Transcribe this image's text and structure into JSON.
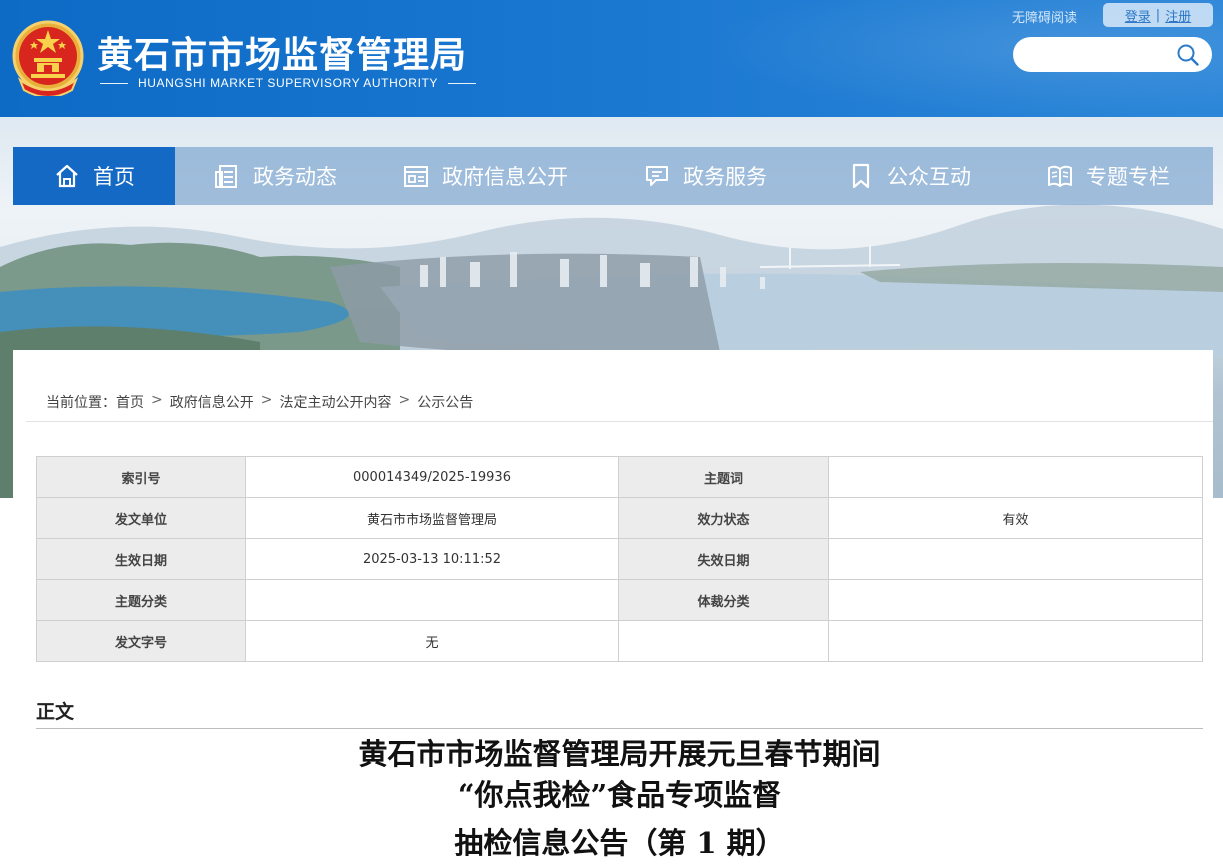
{
  "header": {
    "title": "黄石市市场监督管理局",
    "subtitle": "HUANGSHI MARKET SUPERVISORY AUTHORITY",
    "accessible_reading": "无障碍阅读",
    "login": "登录",
    "register": "注册",
    "auth_separator": "|",
    "search_placeholder": "",
    "emblem_icon": "national-emblem-icon"
  },
  "nav": {
    "items": [
      {
        "label": "首页",
        "icon": "home-icon",
        "active": true
      },
      {
        "label": "政务动态",
        "icon": "news-icon"
      },
      {
        "label": "政府信息公开",
        "icon": "info-disclosure-icon"
      },
      {
        "label": "政务服务",
        "icon": "service-chat-icon"
      },
      {
        "label": "公众互动",
        "icon": "bookmark-icon"
      },
      {
        "label": "专题专栏",
        "icon": "open-book-icon"
      }
    ]
  },
  "breadcrumb": {
    "prefix": "当前位置：",
    "items": [
      "首页",
      "政府信息公开",
      "法定主动公开内容",
      "公示公告"
    ],
    "separator": ">"
  },
  "meta_table": {
    "rows": [
      {
        "k1": "索引号",
        "v1": "000014349/2025-19936",
        "k2": "主题词",
        "v2": ""
      },
      {
        "k1": "发文单位",
        "v1": "黄石市市场监督管理局",
        "k2": "效力状态",
        "v2": "有效"
      },
      {
        "k1": "生效日期",
        "v1": "2025-03-13 10:11:52",
        "k2": "失效日期",
        "v2": ""
      },
      {
        "k1": "主题分类",
        "v1": "",
        "k2": "体裁分类",
        "v2": ""
      },
      {
        "k1": "发文字号",
        "v1": "无",
        "k2": "",
        "v2": ""
      }
    ]
  },
  "content": {
    "section_label": "正文",
    "title_line1": "黄石市市场监督管理局开展元旦春节期间",
    "title_line2": "“你点我检”食品专项监督",
    "title_line3": "抽检信息公告（第 1 期）"
  },
  "colors": {
    "header_blue": "#1570cb",
    "nav_active": "#1369c3",
    "table_key_bg": "#ececec"
  }
}
